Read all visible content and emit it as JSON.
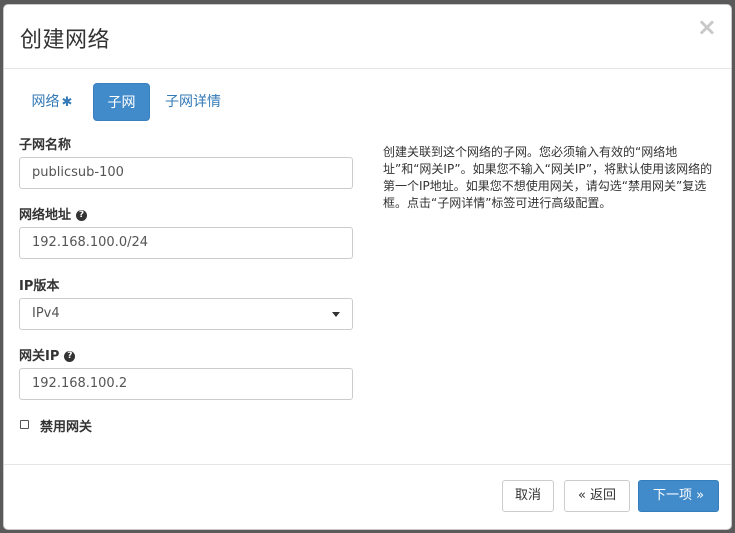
{
  "modal": {
    "title": "创建网络",
    "close_label": "×"
  },
  "tabs": [
    {
      "label": "网络",
      "required_mark": "✱",
      "active": false
    },
    {
      "label": "子网",
      "active": true
    },
    {
      "label": "子网详情",
      "active": false
    }
  ],
  "form": {
    "subnet_name": {
      "label": "子网名称",
      "value": "publicsub-100"
    },
    "network_address": {
      "label": "网络地址",
      "help_icon": "question-circle-icon",
      "value": "192.168.100.0/24"
    },
    "ip_version": {
      "label": "IP版本",
      "selected": "IPv4"
    },
    "gateway_ip": {
      "label": "网关IP",
      "help_icon": "question-circle-icon",
      "value": "192.168.100.2"
    },
    "disable_gateway": {
      "label": "禁用网关",
      "checked": false
    }
  },
  "help_text": "创建关联到这个网络的子网。您必须输入有效的“网络地址”和“网关IP”。如果您不输入“网关IP”，将默认使用该网络的第一个IP地址。如果您不想使用网关，请勾选“禁用网关”复选框。点击“子网详情”标签可进行高级配置。",
  "footer": {
    "cancel": "取消",
    "back_arrow": "«",
    "back": "返回",
    "next": "下一项",
    "next_arrow": "»"
  },
  "colors": {
    "primary": "#428bca",
    "link": "#337ab7",
    "overlay": "#5a5a5a"
  }
}
